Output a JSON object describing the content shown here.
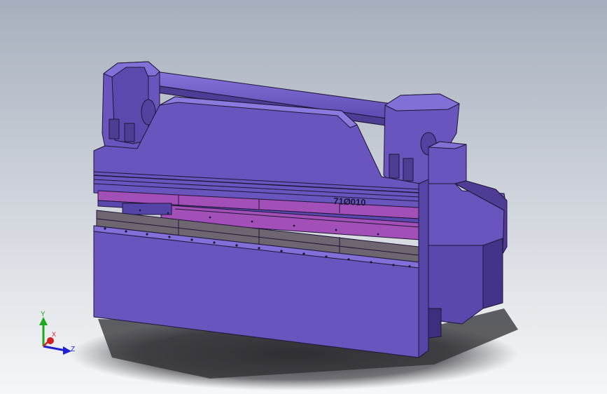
{
  "viewport": {
    "model_label": "71Ø010",
    "colors": {
      "bg_top": "#A6AFBD",
      "bg_bottom": "#F4F5F7",
      "body": "#6A55BE",
      "body_light": "#7F6DD6",
      "body_dark": "#4E3C95",
      "edge": "#1E1636",
      "accent_magenta": "#A24FB8",
      "tool_steel": "#6F6571",
      "shadow": "#2B2A30"
    }
  },
  "triad": {
    "y_label": "Y",
    "x_label": "X",
    "z_label": "Z",
    "y_color": "#1EAA1E",
    "x_color": "#D02020",
    "z_color": "#2020D0"
  }
}
